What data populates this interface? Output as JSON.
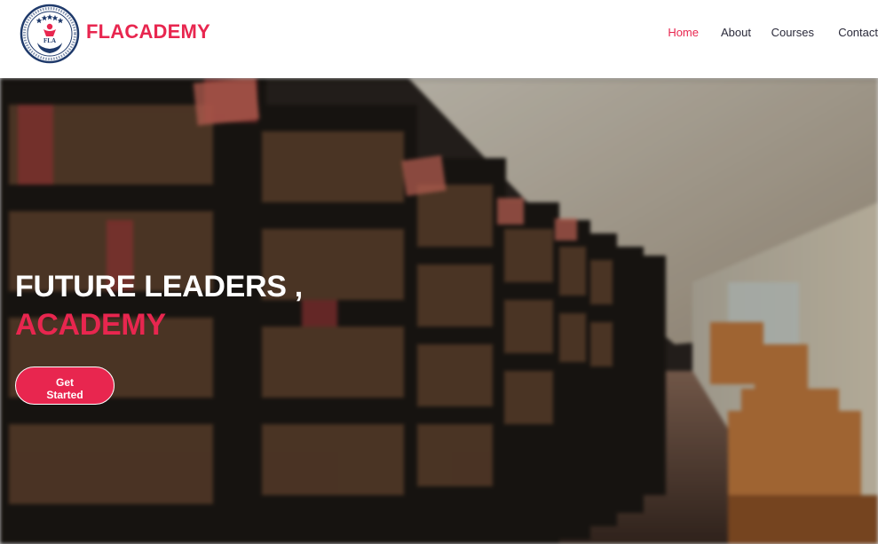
{
  "brand": {
    "name": "FLACADEMY",
    "logo_letters": "FLA"
  },
  "nav": {
    "items": [
      {
        "label": "Home",
        "active": true
      },
      {
        "label": "About",
        "active": false
      },
      {
        "label": "Courses",
        "active": false
      },
      {
        "label": "Contact",
        "active": false
      }
    ]
  },
  "hero": {
    "line1": "FUTURE LEADERS ,",
    "line2": "ACADEMY",
    "cta_label": "Get Started",
    "background": "library-photo"
  },
  "colors": {
    "accent": "#e8264f",
    "nav_text": "#2a2a3a",
    "white": "#ffffff"
  }
}
